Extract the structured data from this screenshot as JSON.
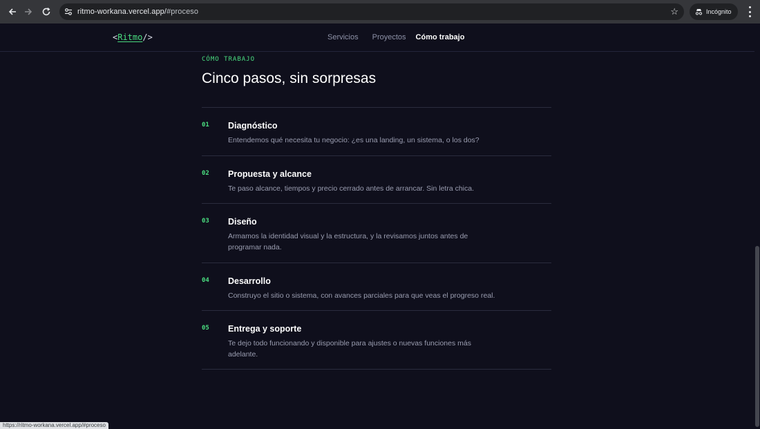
{
  "browser": {
    "url_host": "ritmo-workana.vercel.app/",
    "url_path": "#proceso",
    "profile_label": "Incógnito"
  },
  "header": {
    "logo_open": "<",
    "logo_brand": "Ritmo",
    "logo_close": "/>",
    "nav": [
      {
        "label": "Servicios"
      },
      {
        "label": "Proyectos"
      },
      {
        "label": "Cómo trabajo"
      }
    ]
  },
  "section": {
    "eyebrow": "CÓMO TRABAJO",
    "title": "Cinco pasos, sin sorpresas",
    "steps": [
      {
        "num": "01",
        "title": "Diagnóstico",
        "desc": "Entendemos qué necesita tu negocio: ¿es una landing, un sistema, o los dos?"
      },
      {
        "num": "02",
        "title": "Propuesta y alcance",
        "desc": "Te paso alcance, tiempos y precio cerrado antes de arrancar. Sin letra chica."
      },
      {
        "num": "03",
        "title": "Diseño",
        "desc": "Armamos la identidad visual y la estructura, y la revisamos juntos antes de programar nada."
      },
      {
        "num": "04",
        "title": "Desarrollo",
        "desc": "Construyo el sitio o sistema, con avances parciales para que veas el progreso real."
      },
      {
        "num": "05",
        "title": "Entrega y soporte",
        "desc": "Te dejo todo funcionando y disponible para ajustes o nuevas funciones más adelante."
      }
    ]
  },
  "status_url": "https://ritmo-workana.vercel.app/#proceso",
  "colors": {
    "background": "#0f0f1c",
    "accent": "#4ade80",
    "text_primary": "#ffffff",
    "text_muted": "#9a9db0"
  }
}
